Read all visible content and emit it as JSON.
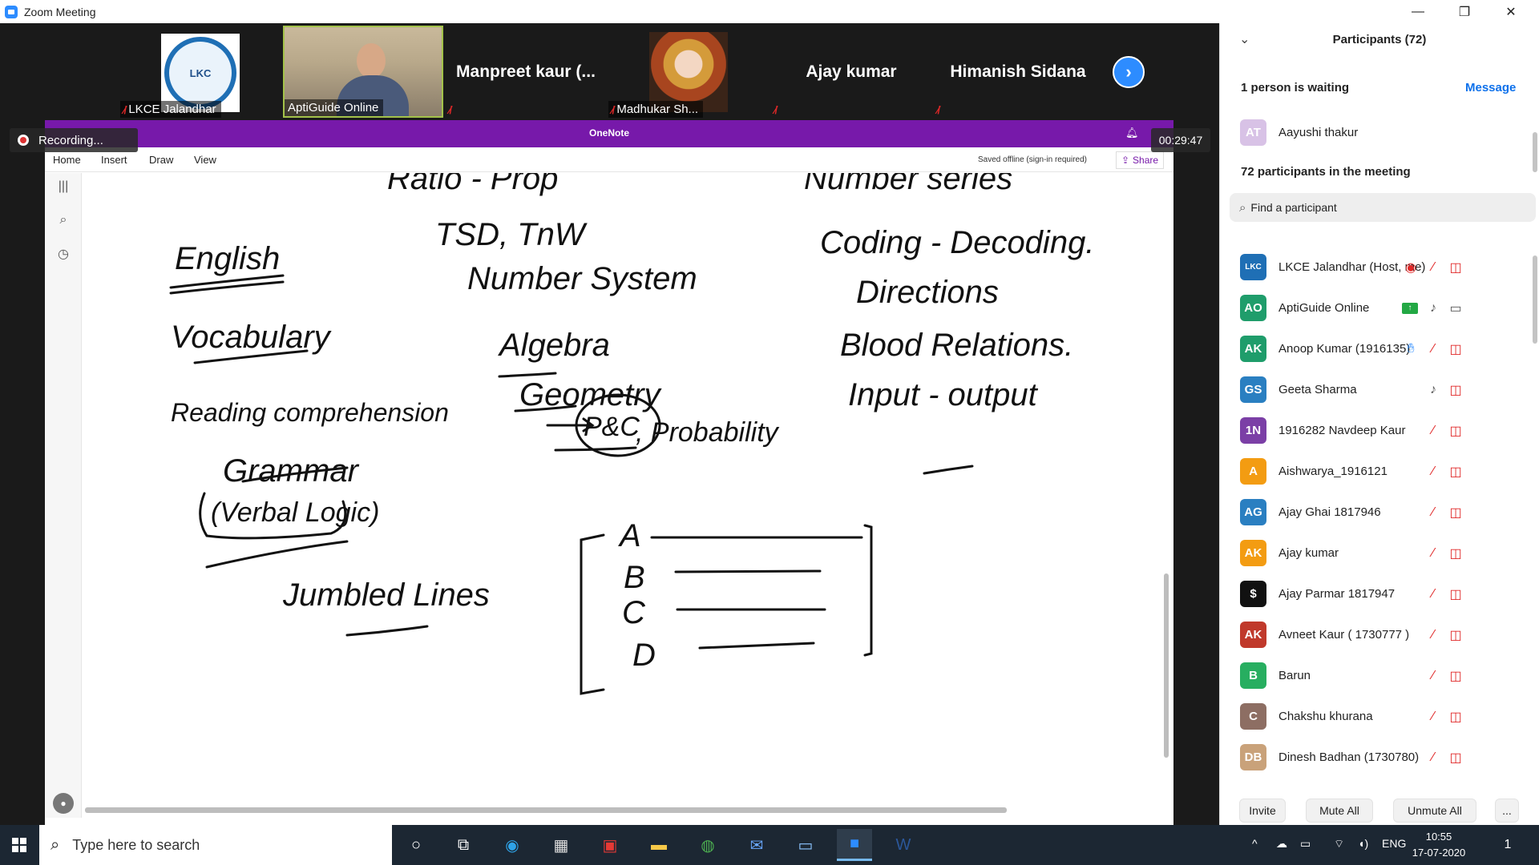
{
  "window": {
    "title": "Zoom Meeting",
    "minimize": "—",
    "restore": "❐",
    "close": "✕"
  },
  "thumbnails": [
    {
      "name": "LKCE Jalandhar",
      "logo_text": "LKC"
    },
    {
      "name": "AptiGuide Online"
    },
    {
      "name": "Manpreet kaur (..."
    },
    {
      "name": "Madhukar Sh..."
    },
    {
      "name": "Ajay kumar"
    },
    {
      "name": "Himanish Sidana"
    }
  ],
  "share": {
    "app_name": "OneNote",
    "recording_label": "Recording...",
    "timer": "00:29:47",
    "ribbon_tabs": [
      "Home",
      "Insert",
      "Draw",
      "View"
    ],
    "saved_status": "Saved offline (sign-in required)",
    "share_label": "Share"
  },
  "notes": {
    "col1": [
      "English",
      "Vocabulary",
      "Reading comprehension",
      "Grammar",
      "(Verbal Logic)",
      "Jumbled Lines"
    ],
    "col2": [
      "Ratio - Prop",
      "TSD, TnW",
      "Number System",
      "Algebra",
      "Geometry",
      "P&C",
      ", Probability"
    ],
    "col3": [
      "Number series",
      "Coding - Decoding.",
      "Directions",
      "Blood Relations.",
      "Input - output"
    ],
    "bracket_letters": [
      "A",
      "B",
      "C",
      "D"
    ]
  },
  "participants_panel": {
    "header": "Participants (72)",
    "waiting": "1 person is waiting",
    "message": "Message",
    "waiting_person": {
      "initials": "AT",
      "name": "Aayushi thakur"
    },
    "in_meeting": "72 participants in the meeting",
    "search_placeholder": "Find a participant",
    "rows": [
      {
        "initials": "LKC",
        "name": "LKCE Jalandhar (Host, me)",
        "color": "#1f6fb5"
      },
      {
        "initials": "AO",
        "name": "AptiGuide Online",
        "color": "#1f9d6b"
      },
      {
        "initials": "AK",
        "name": "Anoop Kumar (1916135)",
        "color": "#1f9d6b"
      },
      {
        "initials": "GS",
        "name": "Geeta Sharma",
        "color": "#2a7fc1"
      },
      {
        "initials": "1N",
        "name": "1916282 Navdeep Kaur",
        "color": "#7b3fa6"
      },
      {
        "initials": "A",
        "name": "Aishwarya_1916121",
        "color": "#f39c12"
      },
      {
        "initials": "AG",
        "name": "Ajay Ghai 1817946",
        "color": "#2a7fc1"
      },
      {
        "initials": "AK",
        "name": "Ajay kumar",
        "color": "#f39c12"
      },
      {
        "initials": "$",
        "name": "Ajay Parmar 1817947",
        "color": "#111111"
      },
      {
        "initials": "AK",
        "name": "Avneet Kaur ( 1730777 )",
        "color": "#c0392b"
      },
      {
        "initials": "B",
        "name": "Barun",
        "color": "#27ae60"
      },
      {
        "initials": "C",
        "name": "Chakshu khurana",
        "color": "#8d6e63"
      },
      {
        "initials": "DB",
        "name": "Dinesh Badhan (1730780)",
        "color": "#c9a27a"
      }
    ],
    "footer": {
      "invite": "Invite",
      "mute_all": "Mute All",
      "unmute_all": "Unmute All",
      "more": "..."
    }
  },
  "taskbar": {
    "search_placeholder": "Type here to search",
    "language": "ENG",
    "time": "10:55",
    "date": "17-07-2020",
    "notifications": "1"
  }
}
